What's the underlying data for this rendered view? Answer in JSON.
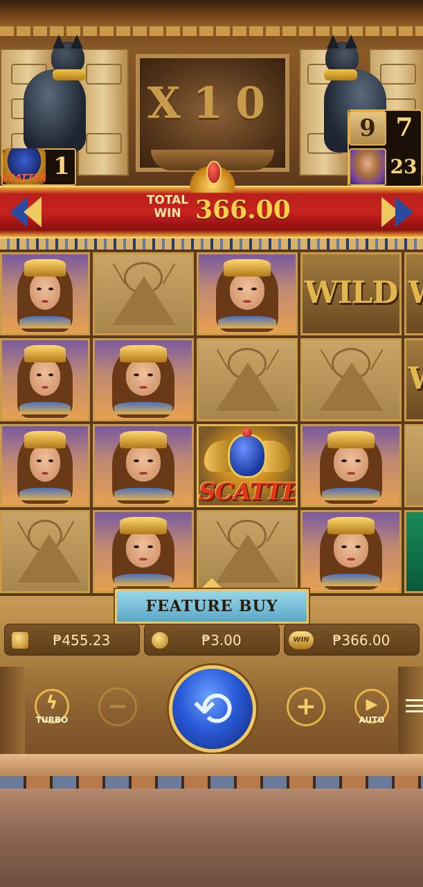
{
  "header": {
    "multiplier": "X10",
    "total_win_label": "TOTAL\nWIN",
    "total_win_value": "366.00"
  },
  "counters": {
    "scatter_label": "SCATTER",
    "scatter_count": "1",
    "right_top_left": "9",
    "right_top_right": "7",
    "right_bottom": "23"
  },
  "reels": {
    "wild_label": "WILD",
    "scatter_label": "SCATTER",
    "columns": [
      [
        "queen",
        "queen",
        "queen",
        "pyramid"
      ],
      [
        "pyramid",
        "queen",
        "queen",
        "queen"
      ],
      [
        "queen",
        "pyramid",
        "scatter",
        "pyramid"
      ],
      [
        "wild",
        "pyramid",
        "queen",
        "queen"
      ],
      [
        "wild",
        "wild",
        "pyramid",
        "green"
      ]
    ]
  },
  "feature_buy": {
    "label": "FEATURE BUY"
  },
  "info_bar": {
    "balance": "₱455.23",
    "bet": "₱3.00",
    "win_tag": "WIN",
    "win": "₱366.00"
  },
  "controls": {
    "turbo_label": "TURBO",
    "auto_label": "AUTO",
    "minus_glyph": "−",
    "plus_glyph": "+",
    "spin_glyph": "⟲"
  },
  "colors": {
    "gold": "#f0c860",
    "banner_red": "#c8221e",
    "spin_blue": "#2a5ad8",
    "win_text": "#ffd24a"
  }
}
